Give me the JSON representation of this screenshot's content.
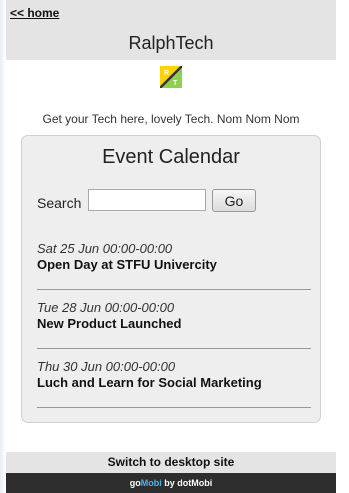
{
  "nav": {
    "home_link": "<< home"
  },
  "header": {
    "site_title": "RalphTech"
  },
  "logo": {
    "letters": [
      "R",
      "T"
    ]
  },
  "tagline": "Get your Tech here, lovely Tech. Nom Nom Nom",
  "calendar": {
    "title": "Event Calendar",
    "search": {
      "label": "Search",
      "value": "",
      "placeholder": "",
      "button_label": "Go"
    },
    "events": [
      {
        "date": "Sat 25 Jun 00:00-00:00",
        "title": "Open Day at STFU Univercity"
      },
      {
        "date": "Tue 28 Jun 00:00-00:00",
        "title": "New Product Launched"
      },
      {
        "date": "Thu 30 Jun 00:00-00:00",
        "title": "Luch and Learn for Social Marketing"
      }
    ]
  },
  "footer": {
    "desktop_link": "Switch to desktop site",
    "brand": {
      "part1": "go",
      "part2": "Mobi",
      "part3": " by dot",
      "part4": "Mobi"
    }
  },
  "colors": {
    "bar_bg": "#e4e4e4",
    "card_bg": "#eeeeee",
    "footer_dark": "#2d2d2d",
    "brand_accent": "#4fb3e8",
    "logo_green": "#8fd14f",
    "logo_yellow": "#ffd200",
    "logo_slash": "#333333"
  }
}
